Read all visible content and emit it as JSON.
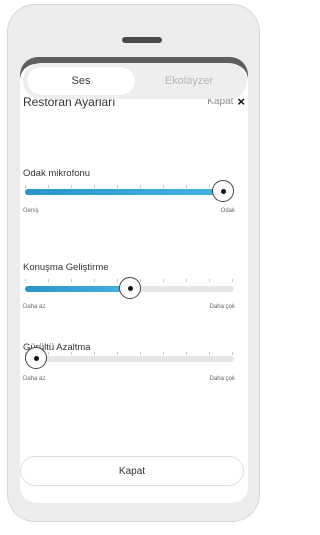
{
  "sheet": {
    "title": "Restoran Ayarları",
    "close_label": "Kapat",
    "close_icon": "×"
  },
  "tabs": [
    {
      "label": "Ses",
      "active": true
    },
    {
      "label": "Ekolayzer",
      "active": false
    }
  ],
  "sliders": [
    {
      "label": "Odak mikrofonu",
      "min_label": "Geniş",
      "max_label": "Odak",
      "value_fraction": 1.0
    },
    {
      "label": "Konuşma Geliştirme",
      "min_label": "Daha az",
      "max_label": "Daha çok",
      "value_fraction": 0.5
    },
    {
      "label": "Gürültü Azaltma",
      "min_label": "Daha az",
      "max_label": "Daha çok",
      "value_fraction": 0.0
    }
  ],
  "footer": {
    "button_label": "Kapat"
  },
  "colors": {
    "accent": "#2a93c8",
    "backdrop": "#5e5e5e"
  }
}
